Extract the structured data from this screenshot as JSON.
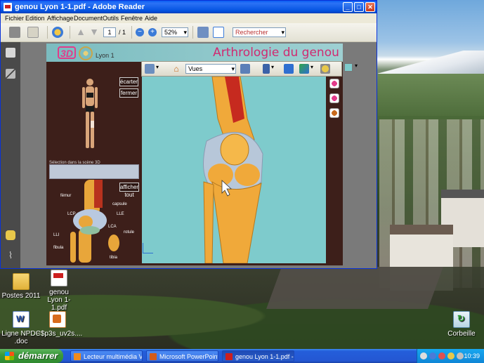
{
  "window": {
    "title": "genou Lyon 1-1.pdf - Adobe Reader",
    "controls": [
      "minimize",
      "maximize",
      "close"
    ]
  },
  "menubar": [
    "Fichier",
    "Edition",
    "Affichage",
    "Document",
    "Outils",
    "Fenêtre",
    "Aide"
  ],
  "toolbar": {
    "page_current": "1",
    "page_total": "/ 1",
    "zoom": "52%",
    "search_placeholder": "Rechercher"
  },
  "document": {
    "logo_text": "3D",
    "org": "Lyon 1",
    "title": "Arthrologie du genou",
    "buttons": {
      "spread": "écarter",
      "close": "fermer",
      "show_all": "afficher tout"
    },
    "selection_label": "Sélection dans la scène 3D",
    "knee_labels": [
      "fémur",
      "capsule",
      "LLE",
      "LCP",
      "LCA",
      "LLI",
      "rotule",
      "fibula",
      "tibia"
    ]
  },
  "viewer": {
    "views_select": "Vues",
    "background_color": "#7ecbcc"
  },
  "desktop_icons": [
    {
      "label": "Postes 2011",
      "icon": "folder-icon"
    },
    {
      "label": "genou Lyon 1-1.pdf",
      "icon": "pdf-icon"
    },
    {
      "label": "Ligne NPDC .doc",
      "icon": "word-doc-icon"
    },
    {
      "label": "~$p3s_uv2s....",
      "icon": "ppt-icon"
    },
    {
      "label": "Corbeille",
      "icon": "recycle-bin-icon"
    }
  ],
  "taskbar": {
    "start_label": "démarrer",
    "tasks": [
      {
        "label": "Lecteur multimédia VLC",
        "color": "#f08a1c"
      },
      {
        "label": "Microsoft PowerPoint ....",
        "color": "#d35b1a"
      },
      {
        "label": "genou Lyon 1-1.pdf -...",
        "color": "#cc1f1f"
      }
    ],
    "clock": "10:39"
  }
}
